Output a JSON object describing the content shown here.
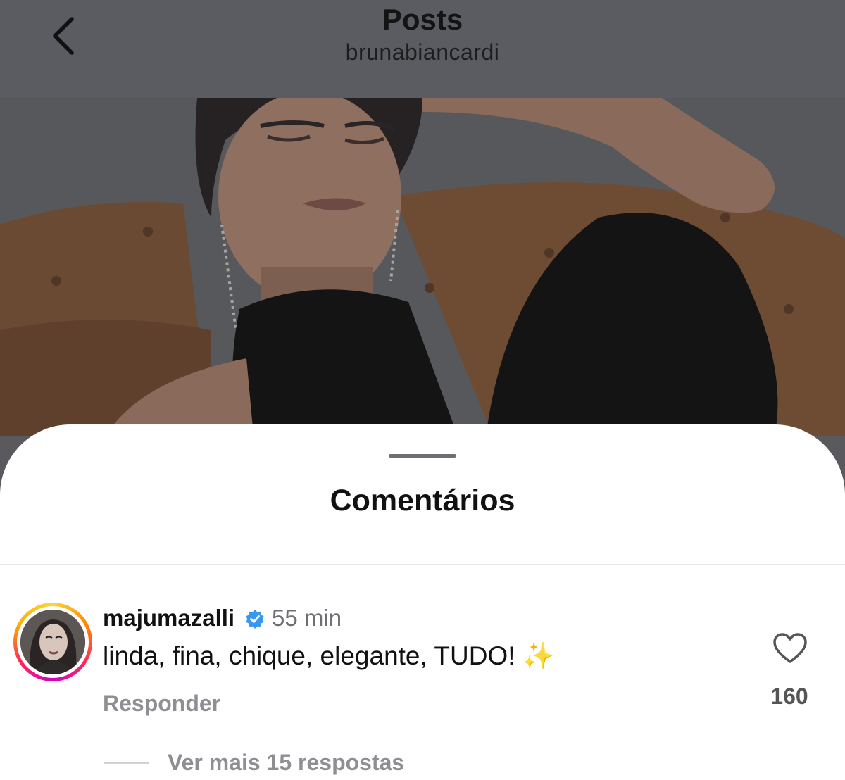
{
  "header": {
    "title": "Posts",
    "username": "brunabiancardi"
  },
  "post": {
    "image_description_icon": "post-photo"
  },
  "comments_sheet": {
    "title": "Comentários",
    "comments": [
      {
        "username": "majumazalli",
        "verified": true,
        "time": "55 min",
        "text": "linda, fina, chique, elegante, TUDO! ",
        "emoji": "✨",
        "reply_label": "Responder",
        "likes": "160",
        "view_more_replies": "Ver mais 15 respostas"
      }
    ]
  },
  "colors": {
    "header_bg": "#5b5c61",
    "sheet_bg": "#ffffff",
    "verified_blue": "#3897f0",
    "muted_text": "#8e8e93"
  }
}
